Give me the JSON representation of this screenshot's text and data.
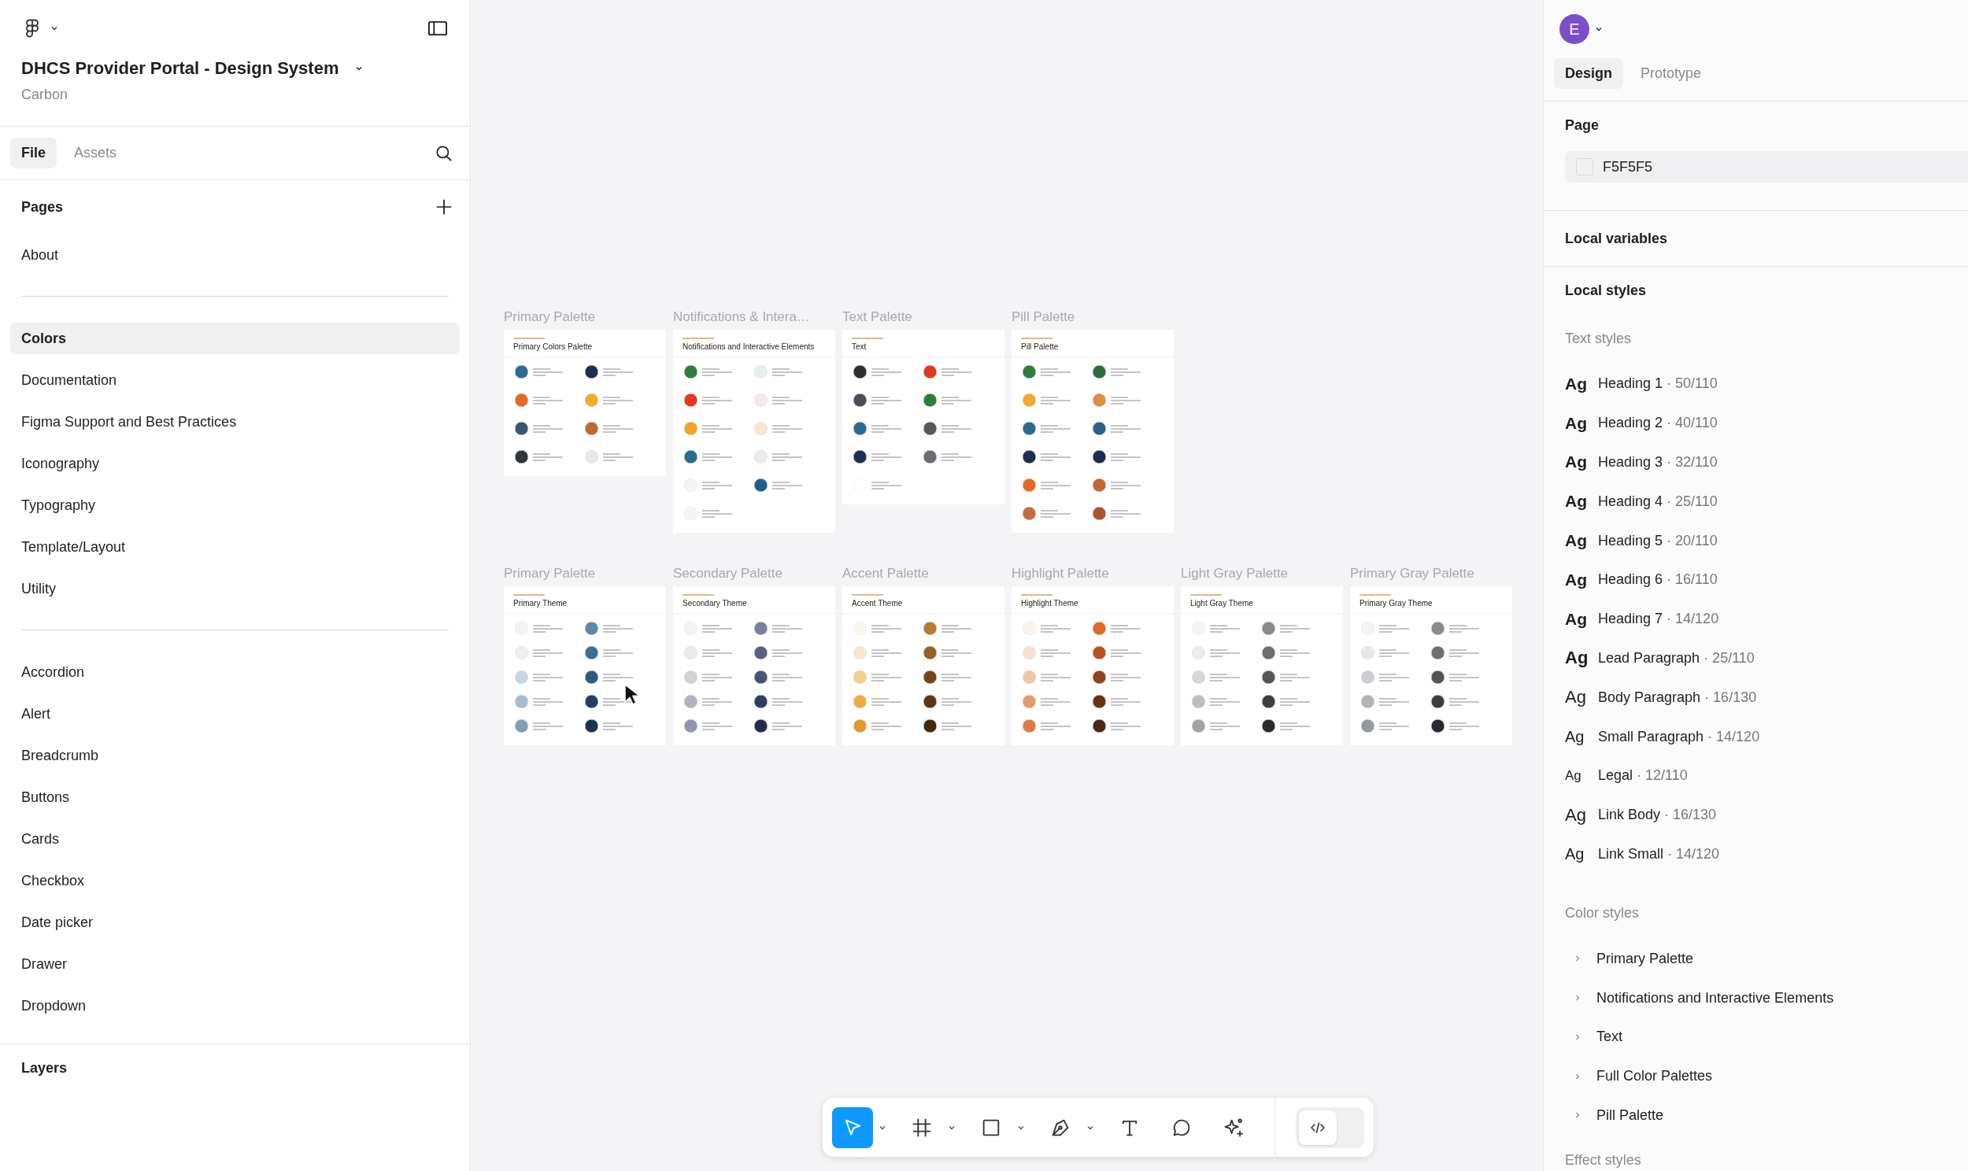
{
  "left_panel": {
    "file_title": "DHCS Provider Portal - Design System",
    "team": "Carbon",
    "tabs": [
      {
        "label": "File",
        "selected": true
      },
      {
        "label": "Assets",
        "selected": false
      }
    ],
    "pages_heading": "Pages",
    "pages": [
      {
        "kind": "page",
        "label": "About",
        "selected": false
      },
      {
        "kind": "divider"
      },
      {
        "kind": "page",
        "label": "Colors",
        "selected": true
      },
      {
        "kind": "page",
        "label": "Documentation",
        "selected": false
      },
      {
        "kind": "page",
        "label": "Figma Support and Best Practices",
        "selected": false
      },
      {
        "kind": "page",
        "label": "Iconography",
        "selected": false
      },
      {
        "kind": "page",
        "label": "Typography",
        "selected": false
      },
      {
        "kind": "page",
        "label": "Template/Layout",
        "selected": false
      },
      {
        "kind": "page",
        "label": "Utility",
        "selected": false
      },
      {
        "kind": "divider"
      },
      {
        "kind": "page",
        "label": "Accordion",
        "selected": false
      },
      {
        "kind": "page",
        "label": "Alert",
        "selected": false
      },
      {
        "kind": "page",
        "label": "Breadcrumb",
        "selected": false
      },
      {
        "kind": "page",
        "label": "Buttons",
        "selected": false
      },
      {
        "kind": "page",
        "label": "Cards",
        "selected": false
      },
      {
        "kind": "page",
        "label": "Checkbox",
        "selected": false
      },
      {
        "kind": "page",
        "label": "Date picker",
        "selected": false
      },
      {
        "kind": "page",
        "label": "Drawer",
        "selected": false
      },
      {
        "kind": "page",
        "label": "Dropdown",
        "selected": false
      }
    ],
    "layers_heading": "Layers"
  },
  "canvas": {
    "frame_rows": [
      {
        "frames": [
          {
            "label": "Primary Palette",
            "heading": "Primary Colors Palette",
            "swatches": [
              {
                "color": "#2e6b90"
              },
              {
                "color": "#1c2f52"
              },
              {
                "color": "#e06a25"
              },
              {
                "color": "#f3a830"
              },
              {
                "color": "#3b5670"
              },
              {
                "color": "#c0683a"
              },
              {
                "color": "#2f353d"
              },
              {
                "color": "#e8e8ea"
              }
            ]
          },
          {
            "label": "Notifications & Intera…",
            "heading": "Notifications and Interactive Elements",
            "swatches": [
              {
                "color": "#2e7d3e"
              },
              {
                "color": "#e6f1ea"
              },
              {
                "color": "#e03a1e"
              },
              {
                "color": "#f3e9e8"
              },
              {
                "color": "#f2a42a"
              },
              {
                "color": "#f8e5d0"
              },
              {
                "color": "#2d6a8f"
              },
              {
                "color": "#ececef"
              },
              {
                "color": "#f4f4f5"
              },
              {
                "color": "#1f5f8f"
              },
              {
                "color": "#f6f6f7"
              }
            ]
          },
          {
            "label": "Text Palette",
            "heading": "Text",
            "swatches": [
              {
                "color": "#2b2e33"
              },
              {
                "color": "#e03a1e"
              },
              {
                "color": "#4a4f57"
              },
              {
                "color": "#2e7d3e"
              },
              {
                "color": "#2d6a8f"
              },
              {
                "color": "#55585e"
              },
              {
                "color": "#1c2f52"
              },
              {
                "color": "#6a6d72"
              },
              {
                "color": "#ffffff"
              }
            ]
          },
          {
            "label": "Pill Palette",
            "heading": "Pill Palette",
            "swatches": [
              {
                "color": "#2e7d3e"
              },
              {
                "color": "#2e6b3a"
              },
              {
                "color": "#f3a830"
              },
              {
                "color": "#dd9040"
              },
              {
                "color": "#2d6a8f"
              },
              {
                "color": "#2e5f85"
              },
              {
                "color": "#1c2f52"
              },
              {
                "color": "#1c2d50"
              },
              {
                "color": "#e06a25"
              },
              {
                "color": "#c8652f"
              },
              {
                "color": "#c46a3a"
              },
              {
                "color": "#a8562f"
              }
            ]
          }
        ]
      },
      {
        "frames": [
          {
            "label": "Primary Palette",
            "heading": "Primary Theme",
            "swatches": [
              {
                "color": "#f3f4f6"
              },
              {
                "color": "#5e87a6"
              },
              {
                "color": "#eceef1"
              },
              {
                "color": "#3f6d93"
              },
              {
                "color": "#c7d6e1"
              },
              {
                "color": "#2f5a7e"
              },
              {
                "color": "#a6bccc"
              },
              {
                "color": "#23415f"
              },
              {
                "color": "#7f9fb8"
              },
              {
                "color": "#1d3349"
              }
            ]
          },
          {
            "label": "Secondary Palette",
            "heading": "Secondary Theme",
            "swatches": [
              {
                "color": "#f3f3f6"
              },
              {
                "color": "#7c7f9a"
              },
              {
                "color": "#e9e9ee"
              },
              {
                "color": "#5a6182"
              },
              {
                "color": "#cfd0d9"
              },
              {
                "color": "#475275"
              },
              {
                "color": "#b0b2c3"
              },
              {
                "color": "#303d63"
              },
              {
                "color": "#9394ad"
              },
              {
                "color": "#1f2c4c"
              }
            ]
          },
          {
            "label": "Accent Palette",
            "heading": "Accent Theme",
            "swatches": [
              {
                "color": "#fbf6ee"
              },
              {
                "color": "#b87a33"
              },
              {
                "color": "#f6e7cc"
              },
              {
                "color": "#9a5f22"
              },
              {
                "color": "#f2cf8c"
              },
              {
                "color": "#754418"
              },
              {
                "color": "#eeae3f"
              },
              {
                "color": "#5e3616"
              },
              {
                "color": "#e29a2e"
              },
              {
                "color": "#432812"
              }
            ]
          },
          {
            "label": "Highlight Palette",
            "heading": "Highlight Theme",
            "swatches": [
              {
                "color": "#fbf3ee"
              },
              {
                "color": "#e06a25"
              },
              {
                "color": "#f6e1d3"
              },
              {
                "color": "#b8501f"
              },
              {
                "color": "#eec6a6"
              },
              {
                "color": "#8f4420"
              },
              {
                "color": "#e59a6b"
              },
              {
                "color": "#6a3118"
              },
              {
                "color": "#e07b3e"
              },
              {
                "color": "#4f2612"
              }
            ]
          },
          {
            "label": "Light Gray Palette",
            "heading": "Light Gray Theme",
            "swatches": [
              {
                "color": "#f5f5f6"
              },
              {
                "color": "#8a8a8c"
              },
              {
                "color": "#ececed"
              },
              {
                "color": "#6e6e70"
              },
              {
                "color": "#d6d6d8"
              },
              {
                "color": "#555557"
              },
              {
                "color": "#bebebf"
              },
              {
                "color": "#3f3f41"
              },
              {
                "color": "#a3a3a5"
              },
              {
                "color": "#2b2b2d"
              }
            ]
          },
          {
            "label": "Primary Gray Palette",
            "heading": "Primary Gray Theme",
            "swatches": [
              {
                "color": "#f4f4f6"
              },
              {
                "color": "#8a8b8e"
              },
              {
                "color": "#e6e7e9"
              },
              {
                "color": "#6d6f73"
              },
              {
                "color": "#cbcdd0"
              },
              {
                "color": "#52555a"
              },
              {
                "color": "#b1b4b8"
              },
              {
                "color": "#3a3d42"
              },
              {
                "color": "#96999e"
              },
              {
                "color": "#262a30"
              }
            ]
          }
        ]
      }
    ],
    "tools": [
      {
        "kind": "move",
        "selected": true,
        "has_menu": true
      },
      {
        "kind": "frame",
        "selected": false,
        "has_menu": true
      },
      {
        "kind": "shape",
        "selected": false,
        "has_menu": true
      },
      {
        "kind": "pen",
        "selected": false,
        "has_menu": true
      },
      {
        "kind": "text",
        "selected": false,
        "has_menu": false
      },
      {
        "kind": "comment",
        "selected": false,
        "has_menu": false
      },
      {
        "kind": "actions",
        "selected": false,
        "has_menu": false
      }
    ],
    "dev_mode": {
      "on": false
    }
  },
  "right_panel": {
    "avatar_initial": "E",
    "tabs": [
      {
        "label": "Design",
        "selected": true
      },
      {
        "label": "Prototype",
        "selected": false
      }
    ],
    "page_heading": "Page",
    "page_color": "F5F5F5",
    "local_variables_heading": "Local variables",
    "local_styles_heading": "Local styles",
    "text_styles_heading": "Text styles",
    "text_styles": [
      {
        "kind": "heading",
        "sample": "Ag",
        "name": "Heading 1",
        "detail": "· 50/110"
      },
      {
        "kind": "heading",
        "sample": "Ag",
        "name": "Heading 2",
        "detail": "· 40/110"
      },
      {
        "kind": "heading",
        "sample": "Ag",
        "name": "Heading 3",
        "detail": "· 32/110"
      },
      {
        "kind": "heading",
        "sample": "Ag",
        "name": "Heading 4",
        "detail": "· 25/110"
      },
      {
        "kind": "heading",
        "sample": "Ag",
        "name": "Heading 5",
        "detail": "· 20/110"
      },
      {
        "kind": "heading",
        "sample": "Ag",
        "name": "Heading 6",
        "detail": "· 16/110"
      },
      {
        "kind": "heading",
        "sample": "Ag",
        "name": "Heading 7",
        "detail": "· 14/120"
      },
      {
        "kind": "lead",
        "sample": "Ag",
        "name": "Lead Paragraph",
        "detail": "· 25/110"
      },
      {
        "kind": "body",
        "sample": "Ag",
        "name": "Body Paragraph",
        "detail": "· 16/130"
      },
      {
        "kind": "small",
        "sample": "Ag",
        "name": "Small Paragraph",
        "detail": "· 14/120"
      },
      {
        "kind": "legal",
        "sample": "Ag",
        "name": "Legal",
        "detail": "· 12/110"
      },
      {
        "kind": "body",
        "sample": "Ag",
        "name": "Link Body",
        "detail": "· 16/130"
      },
      {
        "kind": "small",
        "sample": "Ag",
        "name": "Link Small",
        "detail": "· 14/120"
      }
    ],
    "color_styles_heading": "Color styles",
    "color_styles": [
      {
        "name": "Primary Palette",
        "expanded": false
      },
      {
        "name": "Notifications and Interactive Elements",
        "expanded": false
      },
      {
        "name": "Text",
        "expanded": false
      },
      {
        "name": "Full Color Palettes",
        "expanded": false
      },
      {
        "name": "Pill Palette",
        "expanded": false
      }
    ],
    "effect_styles_heading": "Effect styles"
  }
}
